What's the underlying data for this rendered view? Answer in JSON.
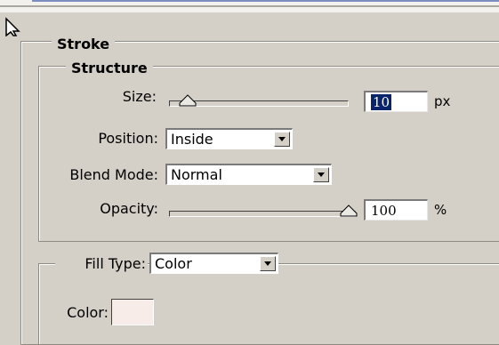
{
  "stroke": {
    "title": "Stroke",
    "structure": {
      "title": "Structure",
      "size": {
        "label": "Size:",
        "value": "10",
        "unit": "px",
        "slider_fraction": 0.05
      },
      "position": {
        "label": "Position:",
        "value": "Inside"
      },
      "blend_mode": {
        "label": "Blend Mode:",
        "value": "Normal"
      },
      "opacity": {
        "label": "Opacity:",
        "value": "100",
        "unit": "%",
        "slider_fraction": 1.0
      }
    },
    "fill": {
      "label": "Fill Type:",
      "value": "Color",
      "color_label": "Color:",
      "color_value": "#f8ece8"
    }
  }
}
